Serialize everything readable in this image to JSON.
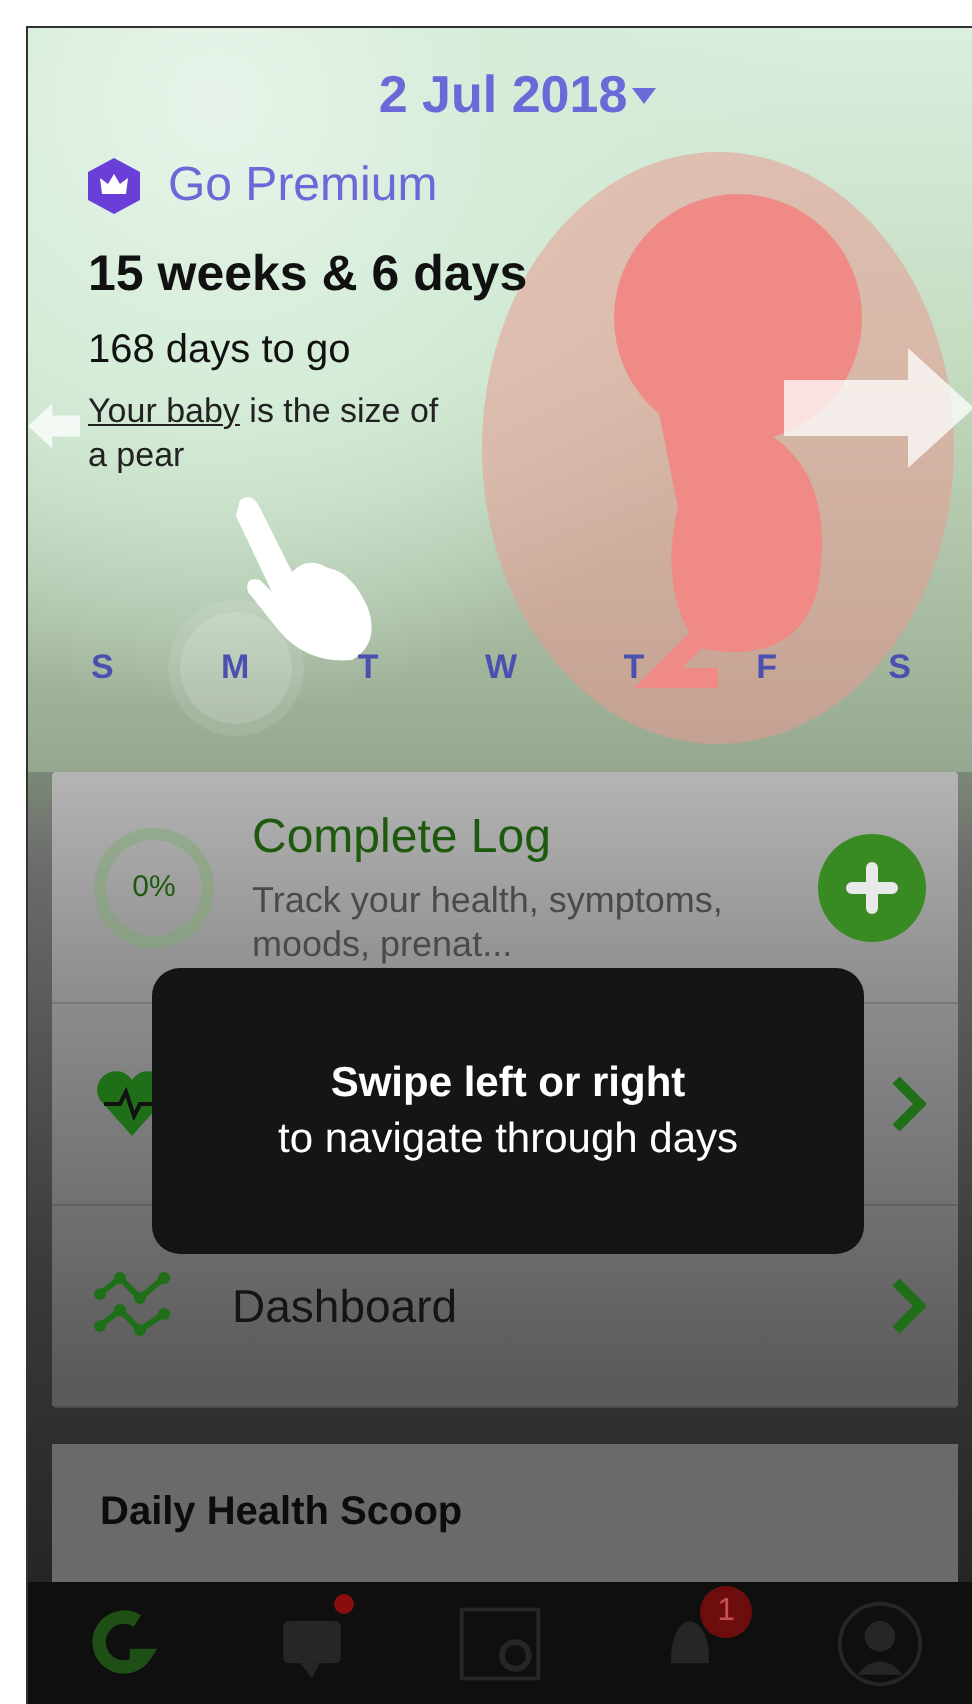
{
  "header": {
    "date": "2 Jul 2018"
  },
  "premium": {
    "label": "Go Premium"
  },
  "pregnancy": {
    "weeks": "15 weeks & 6 days",
    "days_to_go": "168 days to go",
    "size_link": "Your baby",
    "size_text": "is the size of a pear"
  },
  "weekdays": [
    {
      "label": "S",
      "selected": false
    },
    {
      "label": "M",
      "selected": true
    },
    {
      "label": "T",
      "selected": false
    },
    {
      "label": "W",
      "selected": false
    },
    {
      "label": "T",
      "selected": false
    },
    {
      "label": "F",
      "selected": false
    },
    {
      "label": "S",
      "selected": false
    }
  ],
  "log_card": {
    "progress": "0%",
    "level": 0,
    "title": "Complete Log",
    "description": "Track your health, symptoms, moods, prenat..."
  },
  "menu": [
    {
      "kind": "insights"
    },
    {
      "kind": "dashboard",
      "label": "Dashboard"
    }
  ],
  "scoop": {
    "title": "Daily Health Scoop"
  },
  "toast": {
    "title": "Swipe left or right",
    "message": "to navigate through days"
  },
  "tab_bar": [
    {
      "kind": "home",
      "selected": true
    },
    {
      "kind": "chat",
      "selected": false,
      "dot": true
    },
    {
      "kind": "video",
      "selected": false
    },
    {
      "kind": "alerts",
      "selected": false,
      "badge": "1"
    },
    {
      "kind": "profile",
      "selected": false
    }
  ]
}
